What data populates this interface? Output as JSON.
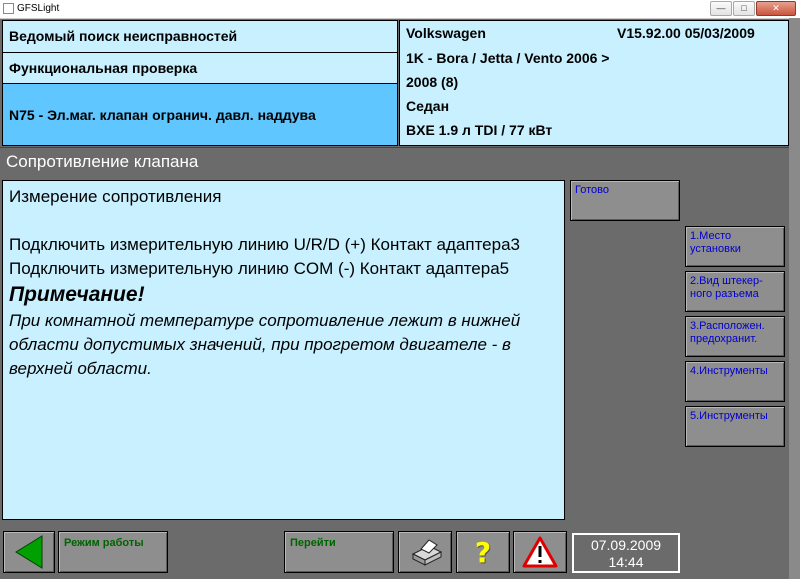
{
  "window": {
    "title": "GFSLight"
  },
  "header": {
    "rows": [
      "Ведомый поиск неисправностей",
      "Функциональная проверка",
      "N75 - Эл.маг. клапан огранич. давл. наддува"
    ],
    "vehicle": {
      "make": "Volkswagen",
      "version": "V15.92.00 05/03/2009",
      "model": "1K - Bora / Jetta / Vento 2006 >",
      "year": "2008 (8)",
      "body": "Седан",
      "engine": "BXE 1.9 л TDI / 77 кВт"
    }
  },
  "section_title": "Сопротивление клапана",
  "content": {
    "line1": "Измерение сопротивления",
    "line2": "Подключить измерительную линию U/R/D (+) Контакт адаптера3",
    "line3": "Подключить измерительную линию COM (-) Контакт адаптера5",
    "note_title": "Примечание!",
    "note_text": " При комнатной температуре сопротивление лежит в нижней области допустимых значений, при прогретом двигателе - в верхней области."
  },
  "side_buttons": {
    "done": "Готово",
    "b1": "1.Место установки",
    "b2": "2.Вид штекер-ного разъема",
    "b3": "3.Расположен. предохранит.",
    "b4": "4.Инструменты",
    "b5": "5.Инструменты"
  },
  "bottom": {
    "mode": "Режим работы",
    "goto": "Перейти",
    "help_glyph": "?",
    "date": "07.09.2009",
    "time": "14:44"
  },
  "colors": {
    "panel": "#c8f0ff",
    "selected": "#5fc6ff",
    "background": "#6b6b6b",
    "link": "#0000d0",
    "back_arrow": "#00a000",
    "help": "#ffff00",
    "warning": "#e00000"
  }
}
